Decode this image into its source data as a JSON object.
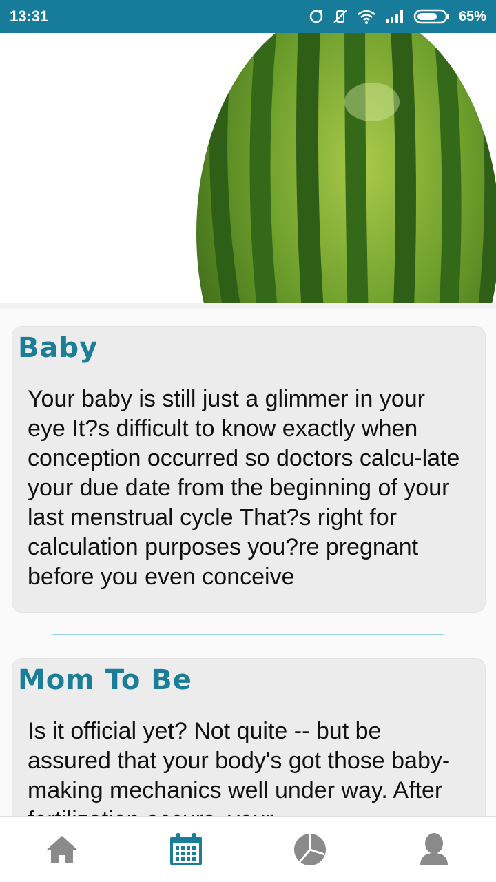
{
  "status_bar": {
    "time": "13:31",
    "battery": "65%",
    "icons": [
      "sync-icon",
      "vibrate-off-icon",
      "wifi-icon",
      "signal-icon",
      "battery-icon"
    ]
  },
  "hero": {
    "image": "watermelon-image"
  },
  "sections": [
    {
      "title": "Baby",
      "text": "Your baby is still just a glimmer in your eye It?s difficult to know exactly when conception occurred so doctors calcu-late your due date from the beginning of your last menstrual cycle That?s right for calculation purposes you?re pregnant before you even conceive"
    },
    {
      "title": "Mom To Be",
      "text": "Is it official yet? Not quite -- but be assured that your body's got those baby-making mechanics well under way. After fertilization occurs, your"
    }
  ],
  "bottom_nav": {
    "items": [
      "home-icon",
      "calendar-icon",
      "pie-chart-icon",
      "profile-icon"
    ],
    "active": "calendar-icon"
  },
  "colors": {
    "status_bar": "#167c99",
    "accent": "#1a7e99",
    "nav_inactive": "#8a8a8a",
    "divider": "#9fd3e3"
  }
}
